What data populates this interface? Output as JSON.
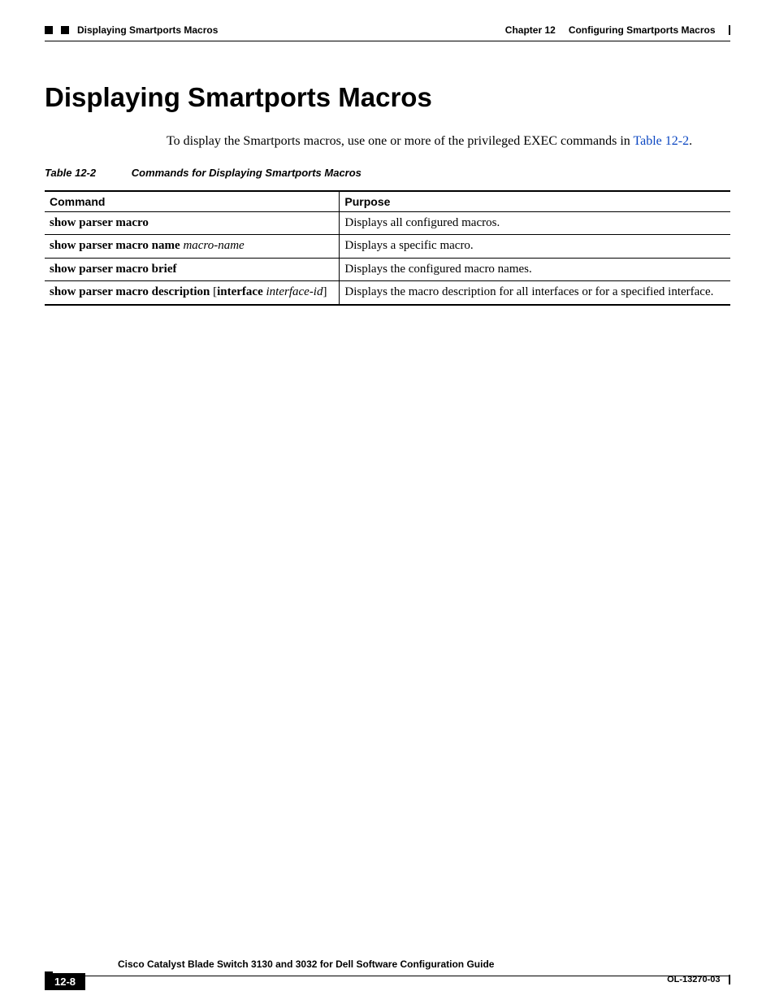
{
  "header": {
    "breadcrumb": "Displaying Smartports Macros",
    "chapter_label": "Chapter 12",
    "chapter_title": "Configuring Smartports Macros"
  },
  "heading": "Displaying Smartports Macros",
  "intro": {
    "pre": "To display the Smartports macros, use one or more of the privileged EXEC commands in ",
    "link": "Table 12-2",
    "post": "."
  },
  "table": {
    "caption_num": "Table 12-2",
    "caption_title": "Commands for Displaying Smartports Macros",
    "head_command": "Command",
    "head_purpose": "Purpose",
    "rows": {
      "0": {
        "cmd_b1": "show parser macro",
        "purpose": "Displays all configured macros."
      },
      "1": {
        "cmd_b1": "show parser macro name ",
        "cmd_i1": "macro-name",
        "purpose": "Displays a specific macro."
      },
      "2": {
        "cmd_b1": "show parser macro brief",
        "purpose": "Displays the configured macro names."
      },
      "3": {
        "cmd_b1": "show parser macro description ",
        "cmd_p1": "[",
        "cmd_b2": "interface ",
        "cmd_i1": "interface-id",
        "cmd_p2": "]",
        "purpose": "Displays the macro description for all interfaces or for a specified interface."
      }
    }
  },
  "footer": {
    "doc_title": "Cisco Catalyst Blade Switch 3130 and 3032 for Dell Software Configuration Guide",
    "page_num": "12-8",
    "doc_id": "OL-13270-03"
  }
}
